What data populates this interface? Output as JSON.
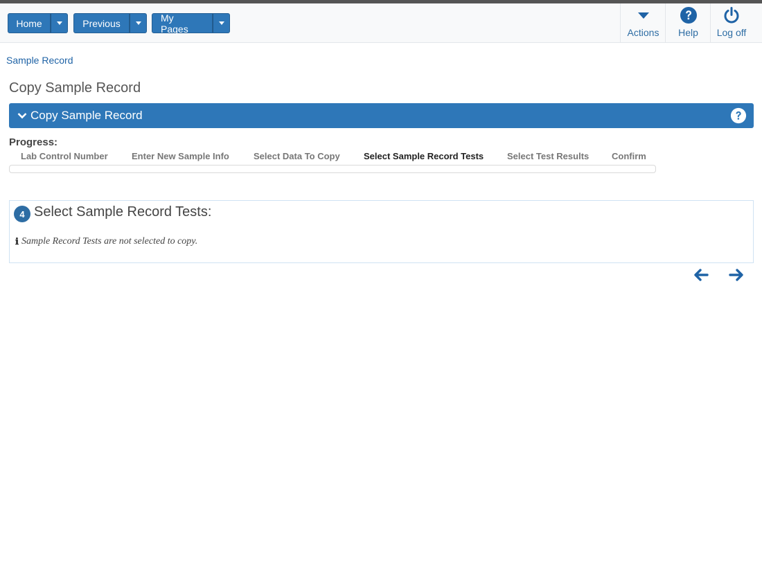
{
  "toolbar": {
    "home_label": "Home",
    "previous_label": "Previous",
    "mypages_label": "My Pages",
    "actions_label": "Actions",
    "help_label": "Help",
    "logoff_label": "Log off",
    "accent_color": "#2e77b8"
  },
  "breadcrumb": {
    "item": "Sample Record"
  },
  "page": {
    "title": "Copy Sample Record"
  },
  "panel": {
    "header": "Copy Sample Record"
  },
  "progress": {
    "label": "Progress:",
    "steps": [
      "Lab Control Number",
      "Enter New Sample Info",
      "Select Data To Copy",
      "Select Sample Record Tests",
      "Select Test Results",
      "Confirm"
    ],
    "active_step": "Select Sample Record Tests"
  },
  "section": {
    "step_number": "4",
    "title": "Select Sample Record Tests:",
    "info_icon": "info-icon",
    "message": "Sample Record Tests are not selected to copy."
  },
  "nav": {
    "back_icon": "arrow-left-icon",
    "next_icon": "arrow-right-icon"
  }
}
